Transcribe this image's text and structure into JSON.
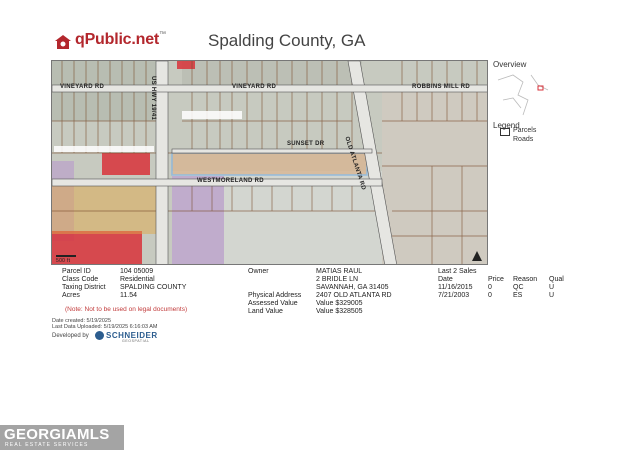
{
  "header": {
    "brand": "qPublic.net",
    "trademark": "™",
    "county": "Spalding County, GA"
  },
  "map": {
    "road_labels": {
      "vineyard_left": "VINEYARD RD",
      "vineyard_mid": "VINEYARD RD",
      "robbins": "ROBBINS MILL RD",
      "old_atlanta": "OLD ATLANTA RD",
      "westmoreland": "WESTMORELAND RD",
      "sunset": "SUNSET DR",
      "us_hwy": "US HWY 19/41",
      "scale": "500 ft"
    }
  },
  "overview": {
    "title": "Overview",
    "legend_title": "Legend",
    "parcels": "Parcels",
    "roads": "Roads"
  },
  "parcel": {
    "parcel_id_label": "Parcel ID",
    "parcel_id": "104 05009",
    "class_code_label": "Class Code",
    "class_code": "Residential",
    "taxing_district_label": "Taxing District",
    "taxing_district": "SPALDING COUNTY",
    "acres_label": "Acres",
    "acres": "11.54"
  },
  "owner": {
    "owner_label": "Owner",
    "name": "MATIAS RAUL",
    "address1": "2 BRIDLE LN",
    "address2": "SAVANNAH, GA 31405",
    "physical_address_label": "Physical Address",
    "physical_address": "2407 OLD ATLANTA RD",
    "assessed_label": "Assessed Value",
    "assessed": "Value $329005",
    "land_label": "Land Value",
    "land": "Value $328505"
  },
  "sales": {
    "title": "Last 2 Sales",
    "headers": [
      "Date",
      "Price",
      "Reason",
      "Qual"
    ],
    "rows": [
      [
        "11/16/2015",
        "0",
        "QC",
        "U"
      ],
      [
        "7/21/2003",
        "0",
        "ES",
        "U"
      ]
    ]
  },
  "note": "(Note: Not to be used on legal documents)",
  "dates": {
    "created": "Date created: 5/19/2025",
    "updated": "Last Data Uploaded: 5/19/2025 6:16:03 AM"
  },
  "developer": {
    "label": "Developed by",
    "company": "SCHNEIDER",
    "sub": "GEOSPATIAL"
  },
  "watermark": {
    "text": "GEORGIAMLS",
    "sub": "REAL ESTATE SERVICES"
  },
  "colors": {
    "brand_red": "#b3272d",
    "parcel_highlight": "#7fb2e0",
    "commercial_red": "#d8323a",
    "purple_zone": "#b89acb"
  }
}
